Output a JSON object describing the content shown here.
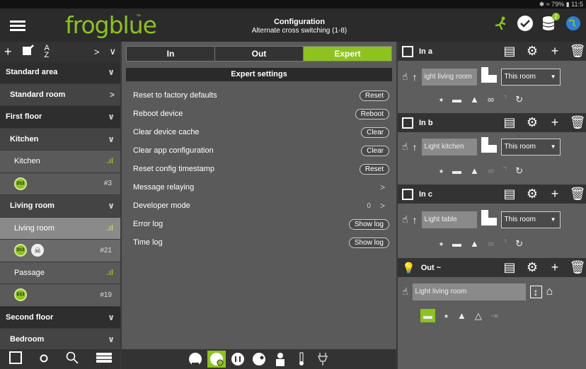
{
  "status": {
    "text": "✱ ≈ 79% ▮ 11:5"
  },
  "app": {
    "logo": "frogblue",
    "logo_tm": "™",
    "title": "Configuration",
    "subtitle": "Alternate cross switching (1-8)",
    "badge": "2"
  },
  "left": {
    "rows": [
      {
        "kind": "area",
        "label": "Standard area",
        "chev": "∨"
      },
      {
        "kind": "room",
        "label": "Standard room",
        "chev": ">"
      },
      {
        "kind": "area",
        "label": "First floor",
        "chev": "∨"
      },
      {
        "kind": "room",
        "label": "Kitchen",
        "chev": "∨"
      },
      {
        "kind": "item",
        "label": "Kitchen",
        "signal": ".ıl"
      },
      {
        "kind": "dev",
        "devices": [
          "D13"
        ],
        "num": "#3"
      },
      {
        "kind": "room",
        "label": "Living room",
        "chev": "∨"
      },
      {
        "kind": "item_sel",
        "label": "Living room",
        "signal": ".ıl"
      },
      {
        "kind": "dev_sel",
        "devices": [
          "D13",
          "skull"
        ],
        "num": "#21"
      },
      {
        "kind": "item",
        "label": "Passage",
        "signal": ".ıl"
      },
      {
        "kind": "dev",
        "devices": [
          "D13"
        ],
        "num": "#19"
      },
      {
        "kind": "area",
        "label": "Second floor",
        "chev": "∨"
      },
      {
        "kind": "room",
        "label": "Bedroom",
        "chev": "∨"
      }
    ]
  },
  "middle": {
    "tabs": [
      "In",
      "Out",
      "Expert"
    ],
    "active_tab": "Expert",
    "settings_title": "Expert settings",
    "settings": [
      {
        "label": "Reset to factory defaults",
        "button": "Reset"
      },
      {
        "label": "Reboot device",
        "button": "Reboot"
      },
      {
        "label": "Clear device cache",
        "button": "Clear"
      },
      {
        "label": "Clear app configuration",
        "button": "Clear"
      },
      {
        "label": "Reset config timestamp",
        "button": "Reset"
      },
      {
        "label": "Message relaying",
        "chev": ">"
      },
      {
        "label": "Developer mode",
        "value": "0",
        "chev": ">"
      },
      {
        "label": "Error log",
        "button": "Show log"
      },
      {
        "label": "Time log",
        "button": "Show log"
      }
    ]
  },
  "right": {
    "channels": [
      {
        "title": "In a",
        "name": "ight living room",
        "scope": "This room"
      },
      {
        "title": "In b",
        "name": "Light kitchen",
        "scope": "This room"
      },
      {
        "title": "In c",
        "name": "Light table",
        "scope": "This room"
      },
      {
        "title": "Out ~",
        "name": "Light living room"
      }
    ]
  },
  "colors": {
    "accent": "#8dc21f",
    "bar": "#2b2b2b",
    "panel": "#5a5a5a"
  }
}
